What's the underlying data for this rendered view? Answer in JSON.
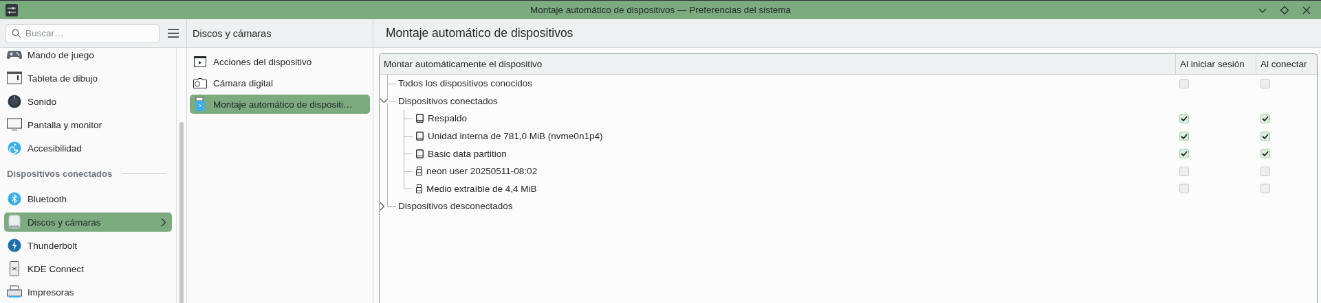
{
  "window": {
    "title": "Montaje automático de dispositivos — Preferencias del sistema"
  },
  "sidebar": {
    "search": {
      "placeholder": "Buscar…"
    },
    "items": [
      {
        "kind": "item",
        "label": "Mando de juego",
        "selected": false
      },
      {
        "kind": "item",
        "label": "Tableta de dibujo",
        "selected": false
      },
      {
        "kind": "item",
        "label": "Sonido",
        "selected": false
      },
      {
        "kind": "item",
        "label": "Pantalla y monitor",
        "selected": false
      },
      {
        "kind": "item",
        "label": "Accesibilidad",
        "selected": false
      },
      {
        "kind": "header",
        "label": "Dispositivos conectados"
      },
      {
        "kind": "item",
        "label": "Bluetooth",
        "selected": false
      },
      {
        "kind": "item",
        "label": "Discos y cámaras",
        "selected": true
      },
      {
        "kind": "item",
        "label": "Thunderbolt",
        "selected": false
      },
      {
        "kind": "item",
        "label": "KDE Connect",
        "selected": false
      },
      {
        "kind": "item",
        "label": "Impresoras",
        "selected": false
      }
    ]
  },
  "category": {
    "title": "Discos y cámaras",
    "items": [
      {
        "label": "Acciones del dispositivo",
        "selected": false
      },
      {
        "label": "Cámara digital",
        "selected": false
      },
      {
        "label": "Montaje automático de dispositi…",
        "selected": true
      }
    ]
  },
  "page": {
    "title": "Montaje automático de dispositivos",
    "table": {
      "columns": [
        "Montar automáticamente el dispositivo",
        "Al iniciar sesión",
        "Al conectar"
      ],
      "rows": [
        {
          "kind": "entry",
          "label": "Todos los dispositivos conocidos",
          "on_login": false,
          "on_connect": false
        },
        {
          "kind": "group",
          "label": "Dispositivos conectados",
          "expanded": true,
          "children": [
            {
              "kind": "drive",
              "label": "Respaldo",
              "on_login": true,
              "on_connect": true
            },
            {
              "kind": "drive",
              "label": "Unidad interna de 781,0 MiB (nvme0n1p4)",
              "on_login": true,
              "on_connect": true
            },
            {
              "kind": "drive",
              "label": "Basic data partition",
              "on_login": true,
              "on_connect": true
            },
            {
              "kind": "usb",
              "label": "neon user 20250511-08:02",
              "on_login": false,
              "on_connect": false
            },
            {
              "kind": "usb",
              "label": "Medio extraíble de 4,4 MiB",
              "on_login": false,
              "on_connect": false
            }
          ]
        },
        {
          "kind": "group",
          "label": "Dispositivos desconectados",
          "expanded": false
        }
      ]
    }
  }
}
